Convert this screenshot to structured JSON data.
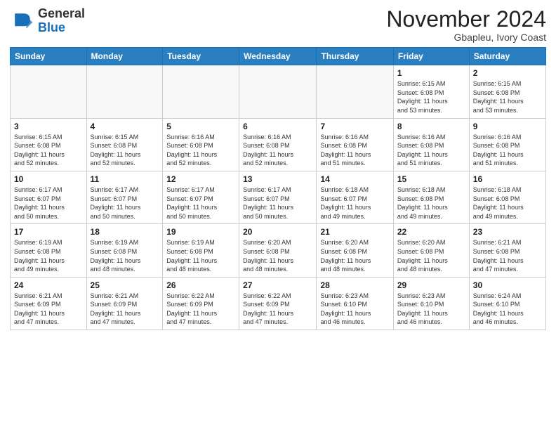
{
  "logo": {
    "general": "General",
    "blue": "Blue"
  },
  "title": "November 2024",
  "location": "Gbapleu, Ivory Coast",
  "days_header": [
    "Sunday",
    "Monday",
    "Tuesday",
    "Wednesday",
    "Thursday",
    "Friday",
    "Saturday"
  ],
  "weeks": [
    [
      {
        "day": "",
        "info": ""
      },
      {
        "day": "",
        "info": ""
      },
      {
        "day": "",
        "info": ""
      },
      {
        "day": "",
        "info": ""
      },
      {
        "day": "",
        "info": ""
      },
      {
        "day": "1",
        "info": "Sunrise: 6:15 AM\nSunset: 6:08 PM\nDaylight: 11 hours\nand 53 minutes."
      },
      {
        "day": "2",
        "info": "Sunrise: 6:15 AM\nSunset: 6:08 PM\nDaylight: 11 hours\nand 53 minutes."
      }
    ],
    [
      {
        "day": "3",
        "info": "Sunrise: 6:15 AM\nSunset: 6:08 PM\nDaylight: 11 hours\nand 52 minutes."
      },
      {
        "day": "4",
        "info": "Sunrise: 6:15 AM\nSunset: 6:08 PM\nDaylight: 11 hours\nand 52 minutes."
      },
      {
        "day": "5",
        "info": "Sunrise: 6:16 AM\nSunset: 6:08 PM\nDaylight: 11 hours\nand 52 minutes."
      },
      {
        "day": "6",
        "info": "Sunrise: 6:16 AM\nSunset: 6:08 PM\nDaylight: 11 hours\nand 52 minutes."
      },
      {
        "day": "7",
        "info": "Sunrise: 6:16 AM\nSunset: 6:08 PM\nDaylight: 11 hours\nand 51 minutes."
      },
      {
        "day": "8",
        "info": "Sunrise: 6:16 AM\nSunset: 6:08 PM\nDaylight: 11 hours\nand 51 minutes."
      },
      {
        "day": "9",
        "info": "Sunrise: 6:16 AM\nSunset: 6:08 PM\nDaylight: 11 hours\nand 51 minutes."
      }
    ],
    [
      {
        "day": "10",
        "info": "Sunrise: 6:17 AM\nSunset: 6:07 PM\nDaylight: 11 hours\nand 50 minutes."
      },
      {
        "day": "11",
        "info": "Sunrise: 6:17 AM\nSunset: 6:07 PM\nDaylight: 11 hours\nand 50 minutes."
      },
      {
        "day": "12",
        "info": "Sunrise: 6:17 AM\nSunset: 6:07 PM\nDaylight: 11 hours\nand 50 minutes."
      },
      {
        "day": "13",
        "info": "Sunrise: 6:17 AM\nSunset: 6:07 PM\nDaylight: 11 hours\nand 50 minutes."
      },
      {
        "day": "14",
        "info": "Sunrise: 6:18 AM\nSunset: 6:07 PM\nDaylight: 11 hours\nand 49 minutes."
      },
      {
        "day": "15",
        "info": "Sunrise: 6:18 AM\nSunset: 6:08 PM\nDaylight: 11 hours\nand 49 minutes."
      },
      {
        "day": "16",
        "info": "Sunrise: 6:18 AM\nSunset: 6:08 PM\nDaylight: 11 hours\nand 49 minutes."
      }
    ],
    [
      {
        "day": "17",
        "info": "Sunrise: 6:19 AM\nSunset: 6:08 PM\nDaylight: 11 hours\nand 49 minutes."
      },
      {
        "day": "18",
        "info": "Sunrise: 6:19 AM\nSunset: 6:08 PM\nDaylight: 11 hours\nand 48 minutes."
      },
      {
        "day": "19",
        "info": "Sunrise: 6:19 AM\nSunset: 6:08 PM\nDaylight: 11 hours\nand 48 minutes."
      },
      {
        "day": "20",
        "info": "Sunrise: 6:20 AM\nSunset: 6:08 PM\nDaylight: 11 hours\nand 48 minutes."
      },
      {
        "day": "21",
        "info": "Sunrise: 6:20 AM\nSunset: 6:08 PM\nDaylight: 11 hours\nand 48 minutes."
      },
      {
        "day": "22",
        "info": "Sunrise: 6:20 AM\nSunset: 6:08 PM\nDaylight: 11 hours\nand 48 minutes."
      },
      {
        "day": "23",
        "info": "Sunrise: 6:21 AM\nSunset: 6:08 PM\nDaylight: 11 hours\nand 47 minutes."
      }
    ],
    [
      {
        "day": "24",
        "info": "Sunrise: 6:21 AM\nSunset: 6:09 PM\nDaylight: 11 hours\nand 47 minutes."
      },
      {
        "day": "25",
        "info": "Sunrise: 6:21 AM\nSunset: 6:09 PM\nDaylight: 11 hours\nand 47 minutes."
      },
      {
        "day": "26",
        "info": "Sunrise: 6:22 AM\nSunset: 6:09 PM\nDaylight: 11 hours\nand 47 minutes."
      },
      {
        "day": "27",
        "info": "Sunrise: 6:22 AM\nSunset: 6:09 PM\nDaylight: 11 hours\nand 47 minutes."
      },
      {
        "day": "28",
        "info": "Sunrise: 6:23 AM\nSunset: 6:10 PM\nDaylight: 11 hours\nand 46 minutes."
      },
      {
        "day": "29",
        "info": "Sunrise: 6:23 AM\nSunset: 6:10 PM\nDaylight: 11 hours\nand 46 minutes."
      },
      {
        "day": "30",
        "info": "Sunrise: 6:24 AM\nSunset: 6:10 PM\nDaylight: 11 hours\nand 46 minutes."
      }
    ]
  ]
}
